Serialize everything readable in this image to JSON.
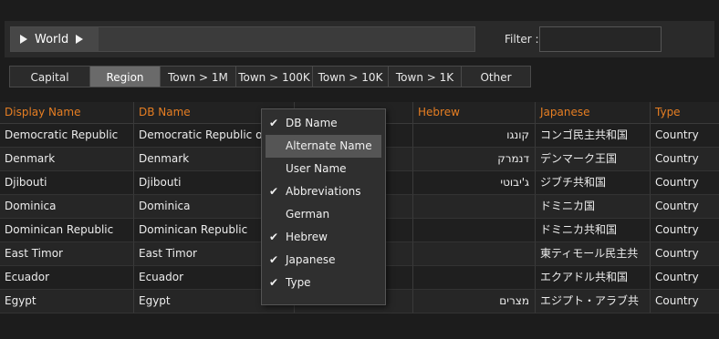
{
  "breadcrumb": {
    "root_label": "World"
  },
  "filter": {
    "label": "Filter :",
    "value": ""
  },
  "tabs": [
    {
      "label": "Capital",
      "selected": false
    },
    {
      "label": "Region",
      "selected": true
    },
    {
      "label": "Town > 1M",
      "selected": false
    },
    {
      "label": "Town > 100K",
      "selected": false
    },
    {
      "label": "Town > 10K",
      "selected": false
    },
    {
      "label": "Town > 1K",
      "selected": false
    },
    {
      "label": "Other",
      "selected": false
    }
  ],
  "table": {
    "headers": [
      "Display Name",
      "DB Name",
      "",
      "Hebrew",
      "Japanese",
      "Type"
    ],
    "rows": [
      [
        "Democratic Republic",
        "Democratic Republic o",
        "",
        "קונגו",
        "コンゴ民主共和国",
        "Country"
      ],
      [
        "Denmark",
        "Denmark",
        "",
        "דנמרק",
        "デンマーク王国",
        "Country"
      ],
      [
        "Djibouti",
        "Djibouti",
        "",
        "ג'יבוטי",
        "ジブチ共和国",
        "Country"
      ],
      [
        "Dominica",
        "Dominica",
        "",
        "",
        "ドミニカ国",
        "Country"
      ],
      [
        "Dominican Republic",
        "Dominican Republic",
        "",
        "",
        "ドミニカ共和国",
        "Country"
      ],
      [
        "East Timor",
        "East Timor",
        "",
        "",
        "東ティモール民主共",
        "Country"
      ],
      [
        "Ecuador",
        "Ecuador",
        "",
        "",
        "エクアドル共和国",
        "Country"
      ],
      [
        "Egypt",
        "Egypt",
        "",
        "מצרים",
        "エジプト・アラブ共",
        "Country"
      ]
    ]
  },
  "column_menu": {
    "items": [
      {
        "label": "DB Name",
        "checked": true,
        "highlighted": false
      },
      {
        "label": "Alternate Name",
        "checked": false,
        "highlighted": true
      },
      {
        "label": "User Name",
        "checked": false,
        "highlighted": false
      },
      {
        "label": "Abbreviations",
        "checked": true,
        "highlighted": false
      },
      {
        "label": "German",
        "checked": false,
        "highlighted": false
      },
      {
        "label": "Hebrew",
        "checked": true,
        "highlighted": false
      },
      {
        "label": "Japanese",
        "checked": true,
        "highlighted": false
      },
      {
        "label": "Type",
        "checked": true,
        "highlighted": false
      }
    ],
    "check_glyph": "✔"
  },
  "colors": {
    "header_text": "#e67e22",
    "background": "#1c1c1c",
    "selected_tab": "#6a6a6a"
  }
}
